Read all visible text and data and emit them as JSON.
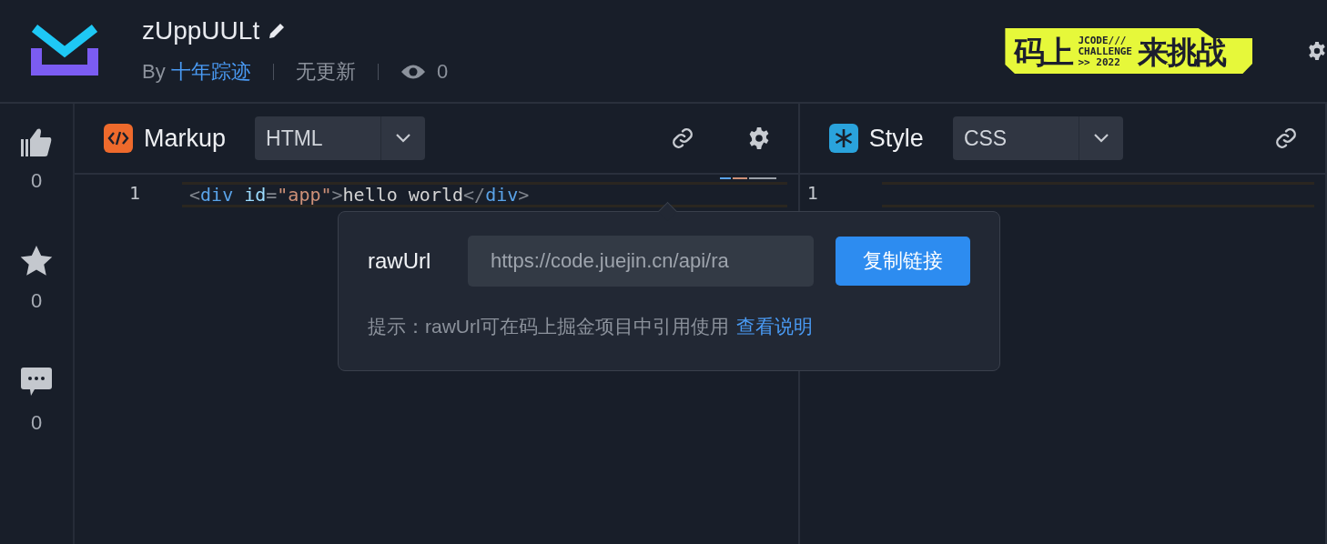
{
  "header": {
    "title": "zUppUULt",
    "by_label": "By",
    "author": "十年踪迹",
    "update_status": "无更新",
    "views": "0",
    "badge": {
      "big_top": "码上",
      "tag1": "JCODE///",
      "tag2": "CHALLENGE",
      "year": ">> 2022",
      "big_bottom": "来挑战"
    }
  },
  "sidebar": {
    "items": [
      {
        "kind": "like",
        "count": "0"
      },
      {
        "kind": "star",
        "count": "0"
      },
      {
        "kind": "comment",
        "count": "0"
      }
    ]
  },
  "panels": [
    {
      "kind": "markup",
      "title": "Markup",
      "language": "HTML",
      "lines": [
        {
          "number": "1",
          "tokens": [
            {
              "kind": "punct",
              "text": "<"
            },
            {
              "kind": "tag",
              "text": "div"
            },
            {
              "kind": "attr",
              "text": "id"
            },
            {
              "kind": "punct",
              "text": "="
            },
            {
              "kind": "string",
              "text": "\"app\""
            },
            {
              "kind": "punct",
              "text": ">"
            },
            {
              "kind": "text",
              "text": "hello world"
            },
            {
              "kind": "punct",
              "text": "</"
            },
            {
              "kind": "tag",
              "text": "div"
            },
            {
              "kind": "punct",
              "text": ">"
            }
          ]
        }
      ]
    },
    {
      "kind": "style",
      "title": "Style",
      "language": "CSS",
      "lines": [
        {
          "number": "1"
        }
      ]
    }
  ],
  "popover": {
    "label": "rawUrl",
    "url_value": "https://code.juejin.cn/api/ra",
    "copy_button": "复制链接",
    "hint": "提示：rawUrl可在码上掘金项目中引用使用",
    "hint_link": "查看说明"
  }
}
